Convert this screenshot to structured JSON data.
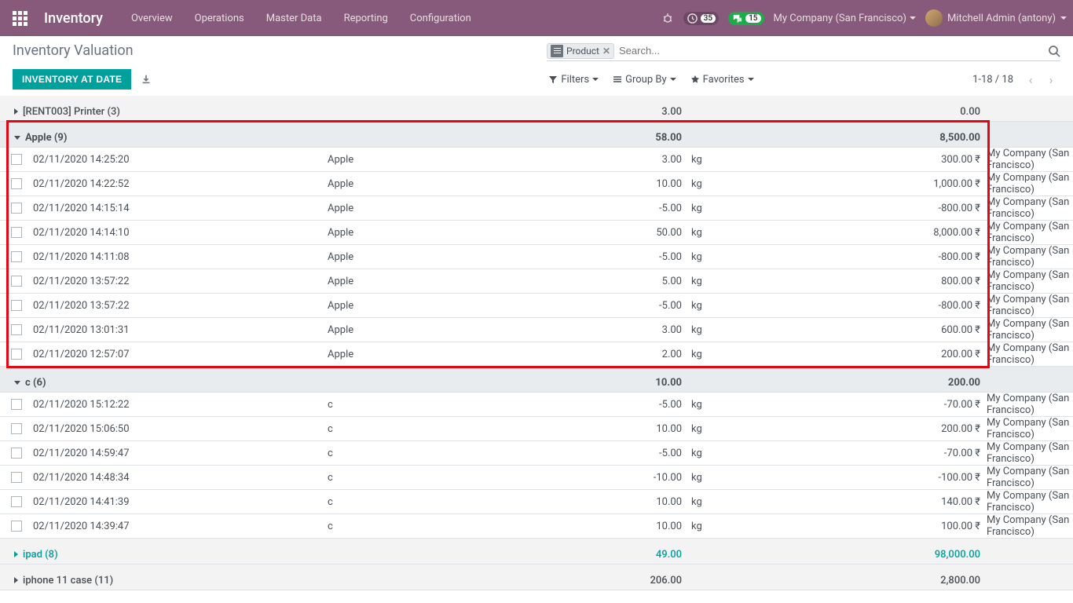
{
  "nav": {
    "app_title": "Inventory",
    "menu": [
      "Overview",
      "Operations",
      "Master Data",
      "Reporting",
      "Configuration"
    ],
    "badge_clock": "35",
    "badge_chat": "15",
    "company": "My Company (San Francisco)",
    "user": "Mitchell Admin (antony)"
  },
  "control": {
    "breadcrumb": "Inventory Valuation",
    "chip_label": "Product",
    "search_placeholder": "Search...",
    "btn_primary": "Inventory at Date",
    "filters_label": "Filters",
    "groupby_label": "Group By",
    "favorites_label": "Favorites",
    "pager_text": "1-18 / 18"
  },
  "groups": [
    {
      "expanded": false,
      "link": false,
      "name": "[RENT003] Printer",
      "count": "(3)",
      "qty": "3.00",
      "value": "0.00",
      "rows": []
    },
    {
      "expanded": true,
      "link": false,
      "name": "Apple",
      "count": "(9)",
      "qty": "58.00",
      "value": "8,500.00",
      "rows": [
        {
          "date": "02/11/2020 14:25:20",
          "product": "Apple",
          "qty": "3.00",
          "unit": "kg",
          "value": "300.00",
          "company": "My Company (San Francisco)"
        },
        {
          "date": "02/11/2020 14:22:52",
          "product": "Apple",
          "qty": "10.00",
          "unit": "kg",
          "value": "1,000.00",
          "company": "My Company (San Francisco)"
        },
        {
          "date": "02/11/2020 14:15:14",
          "product": "Apple",
          "qty": "-5.00",
          "unit": "kg",
          "value": "-800.00",
          "company": "My Company (San Francisco)"
        },
        {
          "date": "02/11/2020 14:14:10",
          "product": "Apple",
          "qty": "50.00",
          "unit": "kg",
          "value": "8,000.00",
          "company": "My Company (San Francisco)"
        },
        {
          "date": "02/11/2020 14:11:08",
          "product": "Apple",
          "qty": "-5.00",
          "unit": "kg",
          "value": "-800.00",
          "company": "My Company (San Francisco)"
        },
        {
          "date": "02/11/2020 13:57:22",
          "product": "Apple",
          "qty": "5.00",
          "unit": "kg",
          "value": "800.00",
          "company": "My Company (San Francisco)"
        },
        {
          "date": "02/11/2020 13:57:22",
          "product": "Apple",
          "qty": "-5.00",
          "unit": "kg",
          "value": "-800.00",
          "company": "My Company (San Francisco)"
        },
        {
          "date": "02/11/2020 13:01:31",
          "product": "Apple",
          "qty": "3.00",
          "unit": "kg",
          "value": "600.00",
          "company": "My Company (San Francisco)"
        },
        {
          "date": "02/11/2020 12:57:07",
          "product": "Apple",
          "qty": "2.00",
          "unit": "kg",
          "value": "200.00",
          "company": "My Company (San Francisco)"
        }
      ]
    },
    {
      "expanded": true,
      "link": false,
      "name": "c",
      "count": "(6)",
      "qty": "10.00",
      "value": "200.00",
      "rows": [
        {
          "date": "02/11/2020 15:12:22",
          "product": "c",
          "qty": "-5.00",
          "unit": "kg",
          "value": "-70.00",
          "company": "My Company (San Francisco)"
        },
        {
          "date": "02/11/2020 15:06:50",
          "product": "c",
          "qty": "10.00",
          "unit": "kg",
          "value": "200.00",
          "company": "My Company (San Francisco)"
        },
        {
          "date": "02/11/2020 14:59:47",
          "product": "c",
          "qty": "-5.00",
          "unit": "kg",
          "value": "-70.00",
          "company": "My Company (San Francisco)"
        },
        {
          "date": "02/11/2020 14:48:34",
          "product": "c",
          "qty": "-10.00",
          "unit": "kg",
          "value": "-100.00",
          "company": "My Company (San Francisco)"
        },
        {
          "date": "02/11/2020 14:41:39",
          "product": "c",
          "qty": "10.00",
          "unit": "kg",
          "value": "140.00",
          "company": "My Company (San Francisco)"
        },
        {
          "date": "02/11/2020 14:39:47",
          "product": "c",
          "qty": "10.00",
          "unit": "kg",
          "value": "100.00",
          "company": "My Company (San Francisco)"
        }
      ]
    },
    {
      "expanded": false,
      "link": true,
      "name": "ipad",
      "count": "(8)",
      "qty": "49.00",
      "value": "98,000.00",
      "rows": []
    },
    {
      "expanded": false,
      "link": false,
      "name": "iphone 11 case",
      "count": "(11)",
      "qty": "206.00",
      "value": "2,800.00",
      "rows": []
    }
  ]
}
